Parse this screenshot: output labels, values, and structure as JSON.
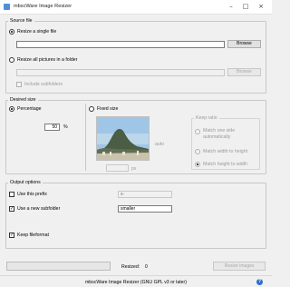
{
  "window": {
    "title": "mbscWare Image Resizer",
    "buttons": {
      "minimize": "–",
      "maximize": "□",
      "close": "×"
    }
  },
  "source_file": {
    "group_title": "Source file",
    "single_option": "Resize a single file",
    "single_path": "",
    "browse_label": "Browse",
    "folder_option": "Resize all pictures in a folder",
    "folder_path": "",
    "folder_browse_label": "Browse",
    "include_subfolders": "Include subfolders",
    "selected": "single"
  },
  "desired_size": {
    "group_title": "Desired size",
    "percentage_label": "Percentage",
    "percentage_value": "50",
    "percent_unit": "%",
    "fixed_label": "Fixed size",
    "width_value": "",
    "width_unit": "px",
    "height_value": "",
    "height_unit": "auto",
    "keep_ratio": {
      "title": "Keep ratio",
      "options": [
        "Match one side automatically",
        "Match width to height",
        "Match height to width"
      ],
      "selected_index": 2
    },
    "selected": "percentage"
  },
  "output_options": {
    "group_title": "Output options",
    "prefix_label": "Use this prefix",
    "prefix_value": "s-",
    "prefix_checked": false,
    "subfolder_label": "Use a new subfolder",
    "subfolder_value": "smaller",
    "subfolder_checked": true,
    "keep_format_label": "Keep fileformat",
    "keep_format_checked": true
  },
  "footer": {
    "resized_label": "Resized:",
    "resized_count": "0",
    "progress": 0,
    "resize_button": "Resize images"
  },
  "status": {
    "text": "mbscWare Image Resizer (GNU GPL v3 or later)",
    "help_icon": "help-icon"
  },
  "colors": {
    "photo_sky": "#9fc6e6",
    "photo_mountain": "#4b5d45",
    "photo_city": "#c9c2ad",
    "help_blue": "#2f6fd0"
  }
}
